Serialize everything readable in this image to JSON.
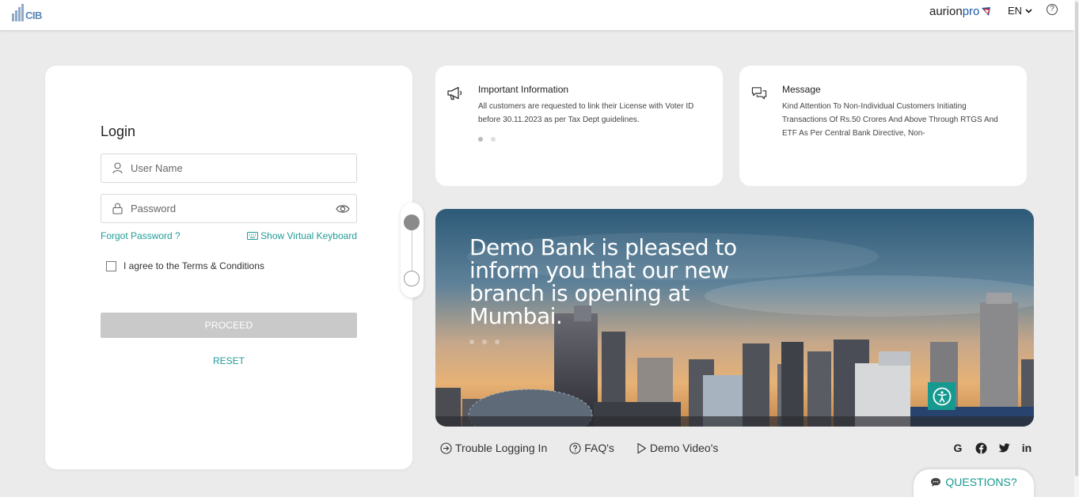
{
  "header": {
    "logo_text": "CIB",
    "brand_main": "aurion",
    "brand_accent": "pro",
    "language": "EN",
    "help_symbol": "?"
  },
  "login": {
    "title": "Login",
    "username_placeholder": "User Name",
    "password_placeholder": "Password",
    "forgot_label": "Forgot Password ?",
    "virtual_keyboard_label": "Show Virtual Keyboard",
    "terms_label": "I agree to the Terms & Conditions",
    "terms_checked": false,
    "proceed_label": "PROCEED",
    "reset_label": "RESET"
  },
  "cards": {
    "info": {
      "title": "Important Information",
      "text": "All customers are requested to link their License with Voter ID before 30.11.2023 as per Tax Dept guidelines.",
      "icon": "megaphone-icon"
    },
    "message": {
      "title": "Message",
      "text": "Kind Attention To Non-Individual Customers Initiating Transactions Of Rs.50 Crores And Above Through RTGS And ETF As Per Central Bank Directive, Non-",
      "icon": "chat-icon"
    }
  },
  "banner": {
    "text": "Demo Bank is pleased to inform you that our new branch is opening at Mumbai."
  },
  "links": {
    "trouble": "Trouble Logging In",
    "faq": "FAQ's",
    "videos": "Demo Video's"
  },
  "social": {
    "google": "G",
    "linkedin": "in"
  },
  "questions_label": "QUESTIONS?",
  "colors": {
    "accent": "#1f9c96",
    "background": "#ebebeb",
    "proceed_disabled": "#c9c9c9"
  }
}
